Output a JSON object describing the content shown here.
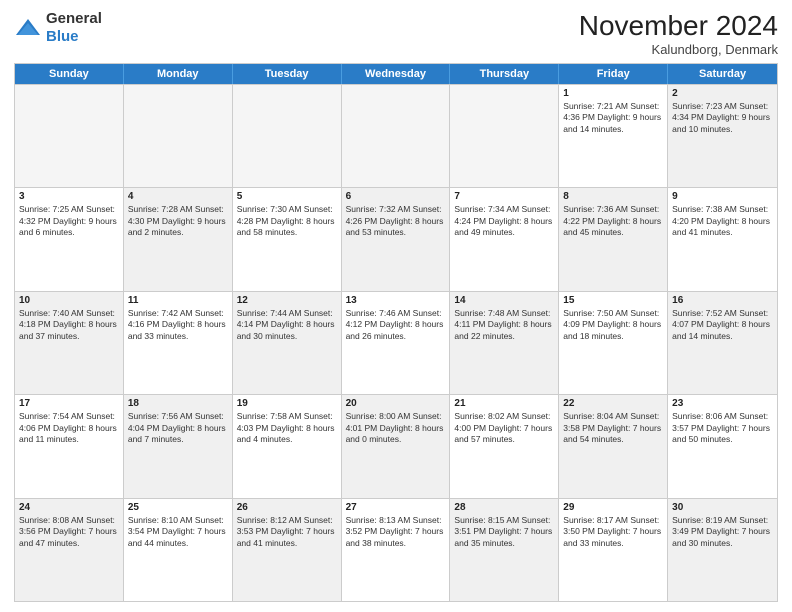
{
  "logo": {
    "line1": "General",
    "line2": "Blue"
  },
  "title": "November 2024",
  "location": "Kalundborg, Denmark",
  "header_days": [
    "Sunday",
    "Monday",
    "Tuesday",
    "Wednesday",
    "Thursday",
    "Friday",
    "Saturday"
  ],
  "rows": [
    [
      {
        "day": "",
        "text": "",
        "empty": true
      },
      {
        "day": "",
        "text": "",
        "empty": true
      },
      {
        "day": "",
        "text": "",
        "empty": true
      },
      {
        "day": "",
        "text": "",
        "empty": true
      },
      {
        "day": "",
        "text": "",
        "empty": true
      },
      {
        "day": "1",
        "text": "Sunrise: 7:21 AM\nSunset: 4:36 PM\nDaylight: 9 hours and 14 minutes.",
        "empty": false
      },
      {
        "day": "2",
        "text": "Sunrise: 7:23 AM\nSunset: 4:34 PM\nDaylight: 9 hours and 10 minutes.",
        "empty": false,
        "shaded": true
      }
    ],
    [
      {
        "day": "3",
        "text": "Sunrise: 7:25 AM\nSunset: 4:32 PM\nDaylight: 9 hours and 6 minutes.",
        "empty": false
      },
      {
        "day": "4",
        "text": "Sunrise: 7:28 AM\nSunset: 4:30 PM\nDaylight: 9 hours and 2 minutes.",
        "empty": false,
        "shaded": true
      },
      {
        "day": "5",
        "text": "Sunrise: 7:30 AM\nSunset: 4:28 PM\nDaylight: 8 hours and 58 minutes.",
        "empty": false
      },
      {
        "day": "6",
        "text": "Sunrise: 7:32 AM\nSunset: 4:26 PM\nDaylight: 8 hours and 53 minutes.",
        "empty": false,
        "shaded": true
      },
      {
        "day": "7",
        "text": "Sunrise: 7:34 AM\nSunset: 4:24 PM\nDaylight: 8 hours and 49 minutes.",
        "empty": false
      },
      {
        "day": "8",
        "text": "Sunrise: 7:36 AM\nSunset: 4:22 PM\nDaylight: 8 hours and 45 minutes.",
        "empty": false,
        "shaded": true
      },
      {
        "day": "9",
        "text": "Sunrise: 7:38 AM\nSunset: 4:20 PM\nDaylight: 8 hours and 41 minutes.",
        "empty": false
      }
    ],
    [
      {
        "day": "10",
        "text": "Sunrise: 7:40 AM\nSunset: 4:18 PM\nDaylight: 8 hours and 37 minutes.",
        "empty": false,
        "shaded": true
      },
      {
        "day": "11",
        "text": "Sunrise: 7:42 AM\nSunset: 4:16 PM\nDaylight: 8 hours and 33 minutes.",
        "empty": false
      },
      {
        "day": "12",
        "text": "Sunrise: 7:44 AM\nSunset: 4:14 PM\nDaylight: 8 hours and 30 minutes.",
        "empty": false,
        "shaded": true
      },
      {
        "day": "13",
        "text": "Sunrise: 7:46 AM\nSunset: 4:12 PM\nDaylight: 8 hours and 26 minutes.",
        "empty": false
      },
      {
        "day": "14",
        "text": "Sunrise: 7:48 AM\nSunset: 4:11 PM\nDaylight: 8 hours and 22 minutes.",
        "empty": false,
        "shaded": true
      },
      {
        "day": "15",
        "text": "Sunrise: 7:50 AM\nSunset: 4:09 PM\nDaylight: 8 hours and 18 minutes.",
        "empty": false
      },
      {
        "day": "16",
        "text": "Sunrise: 7:52 AM\nSunset: 4:07 PM\nDaylight: 8 hours and 14 minutes.",
        "empty": false,
        "shaded": true
      }
    ],
    [
      {
        "day": "17",
        "text": "Sunrise: 7:54 AM\nSunset: 4:06 PM\nDaylight: 8 hours and 11 minutes.",
        "empty": false
      },
      {
        "day": "18",
        "text": "Sunrise: 7:56 AM\nSunset: 4:04 PM\nDaylight: 8 hours and 7 minutes.",
        "empty": false,
        "shaded": true
      },
      {
        "day": "19",
        "text": "Sunrise: 7:58 AM\nSunset: 4:03 PM\nDaylight: 8 hours and 4 minutes.",
        "empty": false
      },
      {
        "day": "20",
        "text": "Sunrise: 8:00 AM\nSunset: 4:01 PM\nDaylight: 8 hours and 0 minutes.",
        "empty": false,
        "shaded": true
      },
      {
        "day": "21",
        "text": "Sunrise: 8:02 AM\nSunset: 4:00 PM\nDaylight: 7 hours and 57 minutes.",
        "empty": false
      },
      {
        "day": "22",
        "text": "Sunrise: 8:04 AM\nSunset: 3:58 PM\nDaylight: 7 hours and 54 minutes.",
        "empty": false,
        "shaded": true
      },
      {
        "day": "23",
        "text": "Sunrise: 8:06 AM\nSunset: 3:57 PM\nDaylight: 7 hours and 50 minutes.",
        "empty": false
      }
    ],
    [
      {
        "day": "24",
        "text": "Sunrise: 8:08 AM\nSunset: 3:56 PM\nDaylight: 7 hours and 47 minutes.",
        "empty": false,
        "shaded": true
      },
      {
        "day": "25",
        "text": "Sunrise: 8:10 AM\nSunset: 3:54 PM\nDaylight: 7 hours and 44 minutes.",
        "empty": false
      },
      {
        "day": "26",
        "text": "Sunrise: 8:12 AM\nSunset: 3:53 PM\nDaylight: 7 hours and 41 minutes.",
        "empty": false,
        "shaded": true
      },
      {
        "day": "27",
        "text": "Sunrise: 8:13 AM\nSunset: 3:52 PM\nDaylight: 7 hours and 38 minutes.",
        "empty": false
      },
      {
        "day": "28",
        "text": "Sunrise: 8:15 AM\nSunset: 3:51 PM\nDaylight: 7 hours and 35 minutes.",
        "empty": false,
        "shaded": true
      },
      {
        "day": "29",
        "text": "Sunrise: 8:17 AM\nSunset: 3:50 PM\nDaylight: 7 hours and 33 minutes.",
        "empty": false
      },
      {
        "day": "30",
        "text": "Sunrise: 8:19 AM\nSunset: 3:49 PM\nDaylight: 7 hours and 30 minutes.",
        "empty": false,
        "shaded": true
      }
    ]
  ]
}
